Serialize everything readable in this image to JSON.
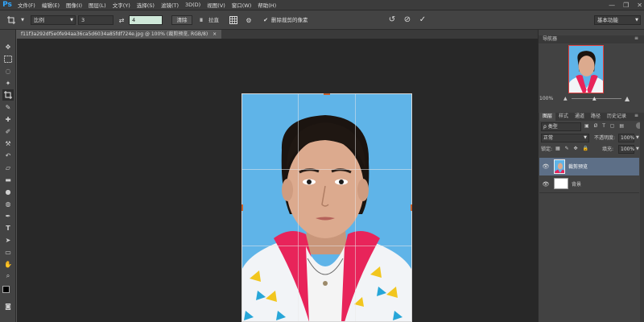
{
  "menubar": {
    "logo": "Ps",
    "items": [
      "文件(F)",
      "编辑(E)",
      "图像(I)",
      "图层(L)",
      "文字(Y)",
      "选择(S)",
      "滤镜(T)",
      "3D(D)",
      "视图(V)",
      "窗口(W)",
      "帮助(H)"
    ],
    "controls": {
      "minimize": "—",
      "restore": "❐",
      "close": "✕"
    }
  },
  "options": {
    "ratio_value": "比例",
    "width_value": "3",
    "height_value": "4",
    "clear_label": "清除",
    "straighten_label": "拉直",
    "delete_cropped_label": "删除裁剪的像素",
    "delete_cropped_checked": true,
    "workspace_value": "基本功能"
  },
  "document": {
    "tab_title": "f11f3a292df5e0fe94aa36ca5d6034a85fdf724e.jpg @ 100% (裁剪预览, RGB/8)",
    "tab_close": "×"
  },
  "navigator": {
    "tab_label": "导航器",
    "zoom_value": "100%"
  },
  "layers": {
    "tabs": [
      "图层",
      "样式",
      "通道",
      "路径",
      "历史记录"
    ],
    "filter_value": "ρ 类型",
    "blend_mode": "正常",
    "opacity_label": "不透明度:",
    "opacity_value": "100%",
    "lock_label": "锁定:",
    "fill_label": "填充:",
    "fill_value": "100%",
    "items": [
      {
        "name": "裁剪预览",
        "selected": true
      },
      {
        "name": "背景",
        "selected": false
      }
    ]
  },
  "colors": {
    "photo_background": "#5fb4e8",
    "shirt_red": "#e8245a",
    "accent_blue": "#31a8ff",
    "crop_handle": "#c8602c"
  }
}
